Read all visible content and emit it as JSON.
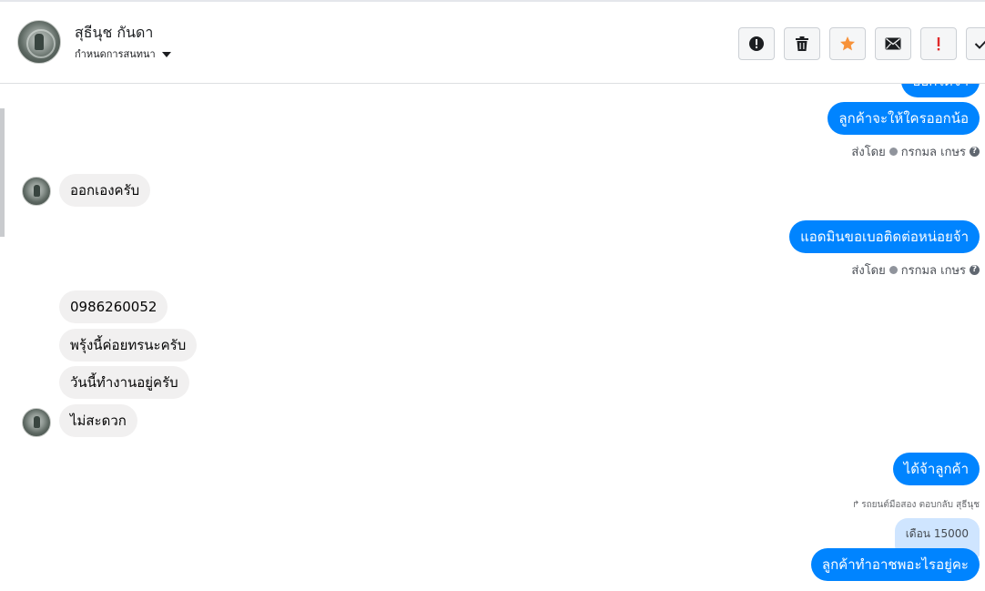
{
  "header": {
    "name": "สุธีนุช กันดา",
    "subtitle": "กำหนดการสนทนา"
  },
  "toolbar": {
    "buttons": [
      {
        "icon": "alert-circle-icon"
      },
      {
        "icon": "trash-icon"
      },
      {
        "icon": "star-icon",
        "color": "#f7923a"
      },
      {
        "icon": "envelope-icon"
      },
      {
        "icon": "exclamation-icon",
        "color": "#e02a2a"
      },
      {
        "icon": "check-icon"
      }
    ]
  },
  "messages": {
    "out_partial": "ออกได้จ้า",
    "out_1": "ลูกค้าจะให้ใครออกน้อ",
    "sent_by_1": {
      "prefix": "ส่งโดย",
      "agent": "กรกมล เกษร"
    },
    "in_1": "ออกเองครับ",
    "out_2": "แอดมินขอเบอติดต่อหน่อยจ้า",
    "sent_by_2": {
      "prefix": "ส่งโดย",
      "agent": "กรกมล เกษร"
    },
    "in_2": "0986260052",
    "in_3": "พรุ้งนี้ค่อยทรนะครับ",
    "in_4": "วันนี้ทำงานอยู่ครับ",
    "in_5": "ไม่สะดวก",
    "out_3": "ได้จ้าลูกค้า",
    "reply_note": "รถยนต์มือสอง ตอบกลับ สุธีนุช",
    "quoted": "เดือน 15000",
    "out_4": "ลูกค้าทำอาชพอะไรอยู่คะ"
  },
  "colors": {
    "outgoing": "#0084ff",
    "incoming": "#f1f0f0",
    "quote": "#cfe5ff"
  }
}
